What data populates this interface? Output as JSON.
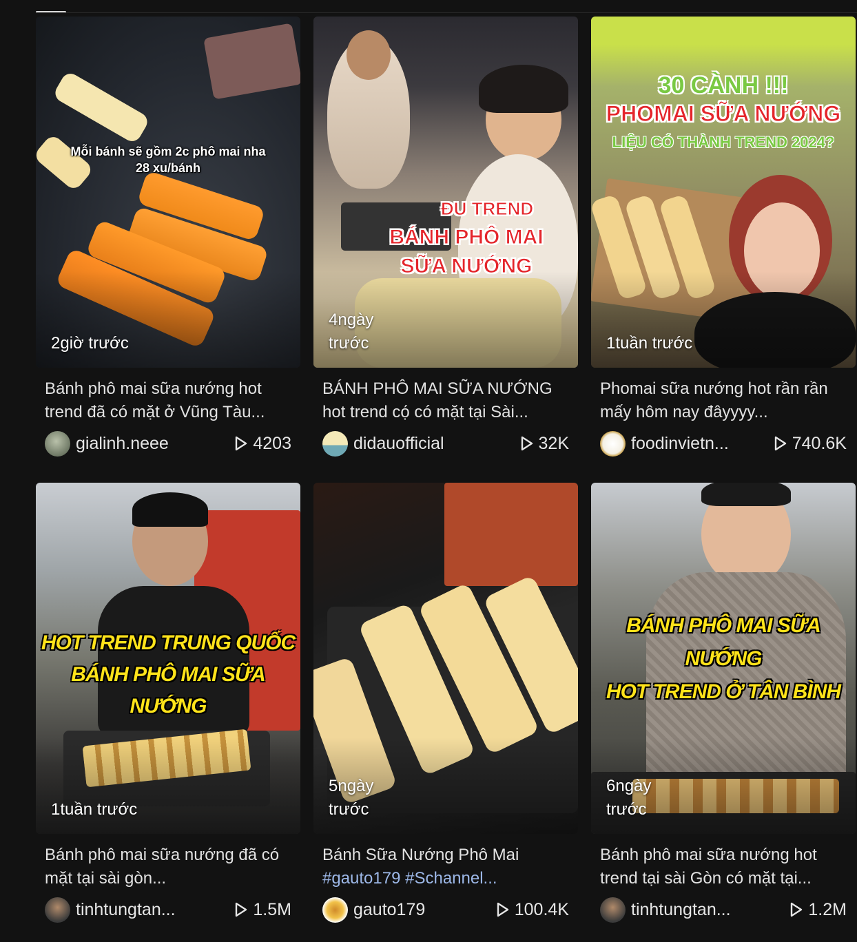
{
  "videos": [
    {
      "time": "2giờ trước",
      "overlay": [
        "Mỗi bánh sẽ gồm 2c phô mai nha",
        "28 xu/bánh"
      ],
      "title": "Bánh phô mai sữa nướng hot trend đã có mặt ở Vũng Tàu...",
      "tags": "",
      "author": "gialinh.neee",
      "views": "4203"
    },
    {
      "time": "4ngày trước",
      "overlay": [
        "ĐU TREND",
        "BÁNH PHÔ MAI",
        "SỮA NƯỚNG"
      ],
      "title": "BÁNH PHÔ MAI SỮA NƯỚNG hot trend cọ́ có mặt tại Sài...",
      "tags": "",
      "author": "didauofficial",
      "views": "32K"
    },
    {
      "time": "1tuần trước",
      "overlay": [
        "30 CÀNH !!!",
        "PHOMAI SỮA NƯỚNG",
        "LIỆU CÓ THÀNH TREND 2024?"
      ],
      "title": "Phomai sữa nướng hot rần rần mấy hôm nay đâyyyy...",
      "tags": "",
      "author": "foodinvietn...",
      "views": "740.6K"
    },
    {
      "time": "1tuần trước",
      "overlay": [
        "HOT TREND TRUNG QUỐC",
        "BÁNH PHÔ MAI SỮA NƯỚNG"
      ],
      "title": "Bánh phô mai sữa nướng đã có mặt tại sài gòn...",
      "tags": "",
      "author": "tinhtungtan...",
      "views": "1.5M"
    },
    {
      "time": "5ngày trước",
      "overlay": [],
      "title": "Bánh Sữa Nướng Phô Mai",
      "tags": "#gauto179 #Schannel...",
      "author": "gauto179",
      "views": "100.4K"
    },
    {
      "time": "6ngày trước",
      "overlay": [
        "BÁNH PHÔ MAI SỮA NƯỚNG",
        "HOT TREND Ở TÂN BÌNH"
      ],
      "title": "Bánh phô mai sữa nướng hot trend tại sài Gòn có mặt tại...",
      "tags": "",
      "author": "tinhtungtan...",
      "views": "1.2M"
    }
  ],
  "colors": {
    "background": "#121212",
    "text": "#e2e2e2",
    "hashtag": "#9db8e8"
  },
  "icons": {
    "views": "play-icon"
  }
}
